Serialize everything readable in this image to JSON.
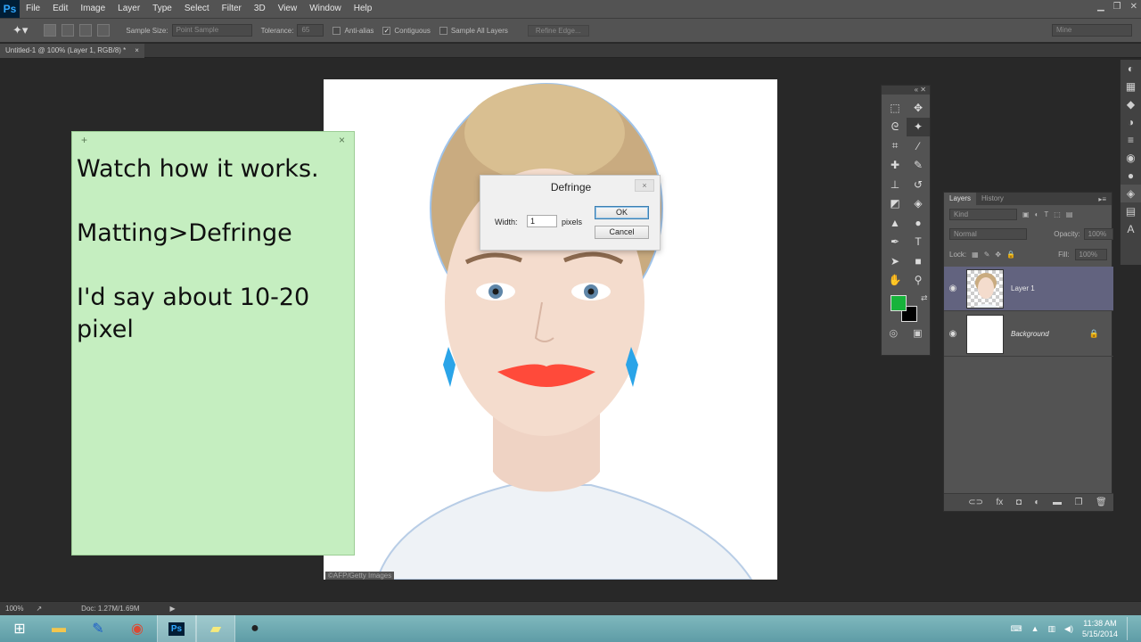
{
  "menubar": {
    "logo": "Ps",
    "items": [
      "File",
      "Edit",
      "Image",
      "Layer",
      "Type",
      "Select",
      "Filter",
      "3D",
      "View",
      "Window",
      "Help"
    ]
  },
  "options": {
    "sample_size_label": "Sample Size:",
    "sample_size_value": "Point Sample",
    "tolerance_label": "Tolerance:",
    "tolerance_value": "65",
    "anti_alias": "Anti-alias",
    "contiguous": "Contiguous",
    "sample_all_layers": "Sample All Layers",
    "refine_edge": "Refine Edge...",
    "workspace": "Mine"
  },
  "document_tab": {
    "title": "Untitled-1 @ 100% (Layer 1, RGB/8) *",
    "close": "×"
  },
  "canvas": {
    "credit": "©AFP/Getty Images"
  },
  "sticky": {
    "add": "+",
    "close": "×",
    "text": "Watch how it works.\n\nMatting>Defringe\n\nI'd say about 10-20\npixel"
  },
  "dialog": {
    "title": "Defringe",
    "width_label": "Width:",
    "width_value": "1",
    "unit": "pixels",
    "ok": "OK",
    "cancel": "Cancel",
    "close": "×"
  },
  "colors": {
    "foreground": "#17b33b",
    "background": "#000000"
  },
  "layers_panel": {
    "tab_layers": "Layers",
    "tab_history": "History",
    "kind": "Kind",
    "blend_mode": "Normal",
    "opacity_label": "Opacity:",
    "opacity_value": "100%",
    "lock_label": "Lock:",
    "fill_label": "Fill:",
    "fill_value": "100%",
    "layers": [
      {
        "name": "Layer 1"
      },
      {
        "name": "Background"
      }
    ]
  },
  "status": {
    "zoom": "100%",
    "doc": "Doc: 1.27M/1.69M"
  },
  "taskbar": {
    "time": "11:38 AM",
    "date": "5/15/2014"
  }
}
